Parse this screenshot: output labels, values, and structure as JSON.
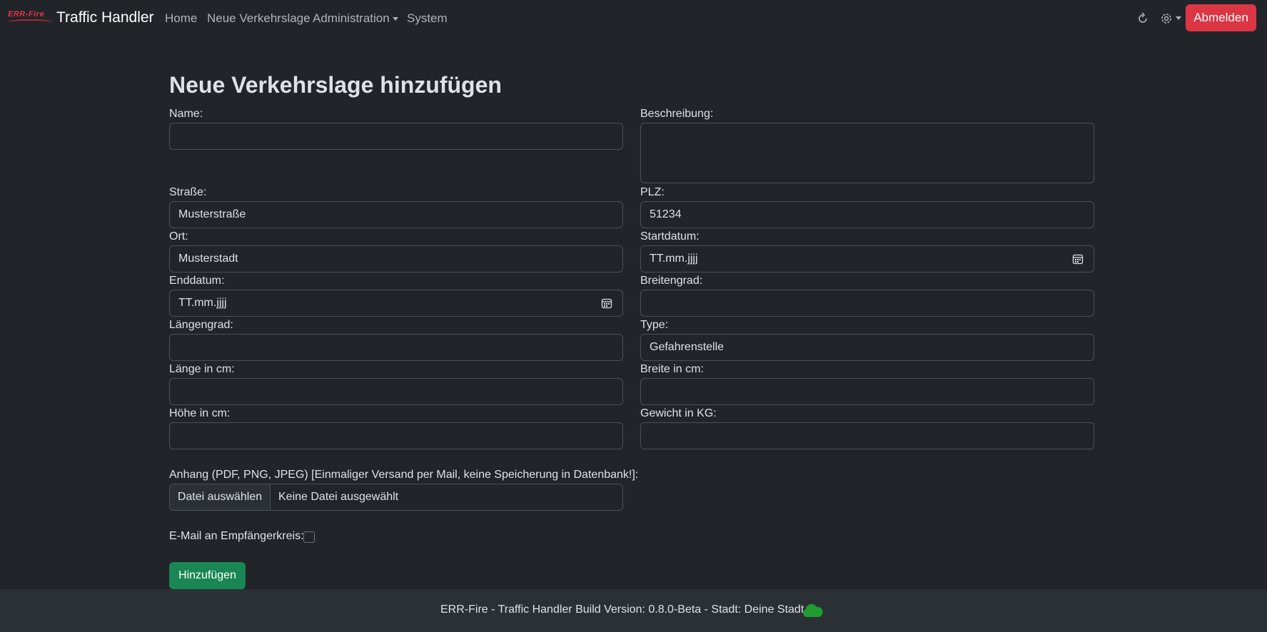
{
  "nav": {
    "logo_text": "ERR-Fire",
    "title": "Traffic Handler",
    "links": [
      "Home",
      "Neue Verkehrslage",
      "Administration",
      "System"
    ],
    "icons": [
      "refresh-icon",
      "gear-icon"
    ],
    "logout_label": "Abmelden"
  },
  "form": {
    "title": "Neue Verkehrslage hinzufügen",
    "name_label": "Name:",
    "name_value": "",
    "beschreibung_label": "Beschreibung:",
    "beschreibung_value": "",
    "strasse_label": "Straße:",
    "strasse_value": "Musterstraße",
    "plz_label": "PLZ:",
    "plz_value": "51234",
    "ort_label": "Ort:",
    "ort_value": "Musterstadt",
    "startdatum_label": "Startdatum:",
    "startdatum_value": "TT.mm.jjjj",
    "enddatum_label": "Enddatum:",
    "enddatum_value": "TT.mm.jjjj",
    "breitengrad_label": "Breitengrad:",
    "breitengrad_value": "",
    "laengengrad_label": "Längengrad:",
    "laengengrad_value": "",
    "type_label": "Type:",
    "type_value": "Gefahrenstelle",
    "laenge_label": "Länge in cm:",
    "laenge_value": "",
    "breite_label": "Breite in cm:",
    "breite_value": "",
    "hoehe_label": "Höhe in cm:",
    "hoehe_value": "",
    "gewicht_label": "Gewicht in KG:",
    "gewicht_value": "",
    "anhang_label": "Anhang (PDF, PNG, JPEG) [Einmaliger Versand per Mail, keine Speicherung in Datenbank!]:",
    "file_button": "Datei auswählen",
    "file_status": "Keine Datei ausgewählt",
    "email_label": "E-Mail an Empfängerkreis:",
    "email_checked": false,
    "submit_label": "Hinzufügen"
  },
  "footer": {
    "text": "ERR-Fire - Traffic Handler Build Version: 0.8.0-Beta - Stadt: Deine Stadt",
    "status_icon": "cloud-icon",
    "status_color": "#1f9d2e"
  },
  "colors": {
    "background": "#212529",
    "danger": "#dc3545",
    "success": "#198754"
  }
}
